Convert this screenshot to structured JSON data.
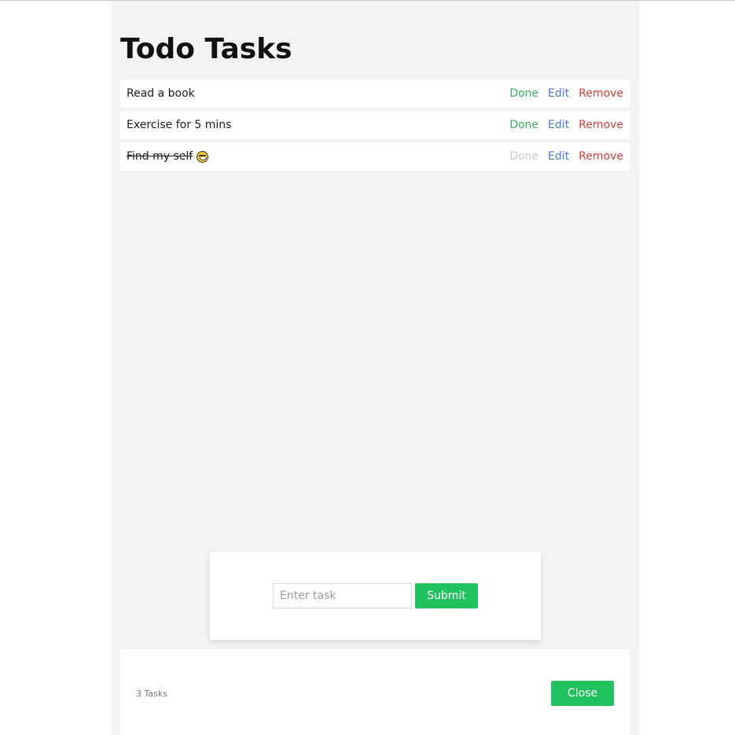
{
  "app": {
    "title": "Todo Tasks",
    "accent_color": "#22c35e"
  },
  "tasks": [
    {
      "text": "Read a book",
      "done": false,
      "actions": {
        "done": "Done",
        "edit": "Edit",
        "remove": "Remove"
      }
    },
    {
      "text": "Exercise for 5 mins",
      "done": false,
      "actions": {
        "done": "Done",
        "edit": "Edit",
        "remove": "Remove"
      }
    },
    {
      "text": "Find my self",
      "done": true,
      "emoji": "grinning-face-emoji",
      "actions": {
        "done": "Done",
        "edit": "Edit",
        "remove": "Remove"
      }
    }
  ],
  "form": {
    "input_value": "",
    "input_placeholder": "Enter task",
    "submit_label": "Submit"
  },
  "footer": {
    "count_text": "3 Tasks",
    "close_label": "Close"
  }
}
